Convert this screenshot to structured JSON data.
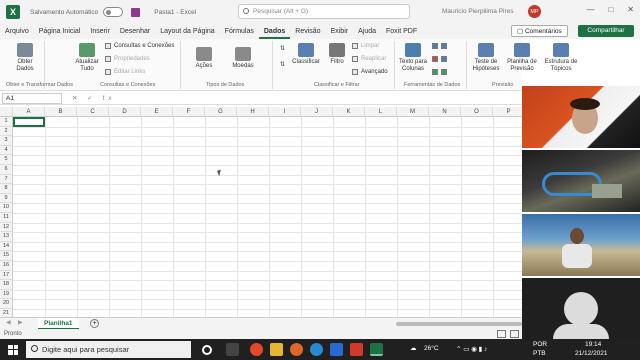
{
  "app": {
    "logo_letter": "X",
    "autosave_label": "Salvamento Automático",
    "doc_title": "Pasta1 - Excel",
    "search_placeholder": "Pesquisar (Alt + G)",
    "user_name": "Mauricio Pierpilima Pires",
    "user_initials": "MP",
    "brand_color": "#1e7145"
  },
  "menu": {
    "items": [
      "Arquivo",
      "Página Inicial",
      "Inserir",
      "Desenhar",
      "Layout da Página",
      "Fórmulas",
      "Dados",
      "Revisão",
      "Exibir",
      "Ajuda",
      "Foxit PDF"
    ],
    "active": "Dados",
    "comments_label": "Comentários",
    "share_label": "Compartilhar"
  },
  "ribbon": {
    "obter_dados": "Obter Dados",
    "atualizar_tudo": "Atualizar Tudo",
    "consultas_conexoes": "Consultas e Conexões",
    "propriedades": "Propriedades",
    "editar_links": "Editar Links",
    "acoes": "Ações",
    "moedas": "Moedas",
    "classificar": "Classificar",
    "filtro": "Filtro",
    "limpar": "Limpar",
    "reaplicar": "Reaplicar",
    "avancado": "Avançado",
    "texto_colunas": "Texto para Colunas",
    "teste_hipoteses": "Teste de Hipóteses",
    "planilha_previsao": "Planilha de Previsão",
    "estrutura_topicos": "Estrutura de Tópicos",
    "groups": {
      "obter": "Obter e Transformar Dados",
      "consultas": "Consultas e Conexões",
      "tipos": "Tipos de Dados",
      "classificar": "Classificar e Filtrar",
      "ferramentas": "Ferramentas de Dados",
      "previsao": "Previsão"
    }
  },
  "formula_bar": {
    "name_box": "A1",
    "fx": "✕ ✓ fx"
  },
  "sheet": {
    "columns": [
      "A",
      "B",
      "C",
      "D",
      "E",
      "F",
      "G",
      "H",
      "I",
      "J",
      "K",
      "L",
      "M",
      "N",
      "O",
      "P"
    ],
    "rows": [
      "1",
      "2",
      "3",
      "4",
      "5",
      "6",
      "7",
      "8",
      "9",
      "10",
      "11",
      "12",
      "13",
      "14",
      "15",
      "16",
      "17",
      "18",
      "19",
      "20",
      "21"
    ],
    "tab_name": "Planilha1",
    "status": "Pronto"
  },
  "taskbar": {
    "search_placeholder": "Digite aqui para pesquisar",
    "weather": "26°C",
    "lang_top": "POR",
    "lang_bottom": "PTB",
    "time": "19:14",
    "date": "21/12/2021"
  }
}
